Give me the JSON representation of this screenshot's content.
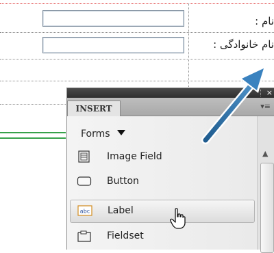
{
  "form": {
    "first_name_label": "نام :",
    "last_name_label": "نام خانوادگی :"
  },
  "insert_panel": {
    "close_glyph": "×",
    "tab_label": "INSERT",
    "menu_glyph": "▾≡",
    "category": "Forms",
    "items": [
      {
        "label": "Image Field",
        "icon": "image-field-icon"
      },
      {
        "label": "Button",
        "icon": "button-icon"
      },
      {
        "label": "Label",
        "icon": "label-icon",
        "icon_text": "abc",
        "selected": true
      },
      {
        "label": "Fieldset",
        "icon": "fieldset-icon"
      }
    ],
    "scroll_up_glyph": "▲"
  },
  "colors": {
    "arrow": "#2a6fa6",
    "guide_line": "#36a14a",
    "panel_bg": "#ececec"
  }
}
